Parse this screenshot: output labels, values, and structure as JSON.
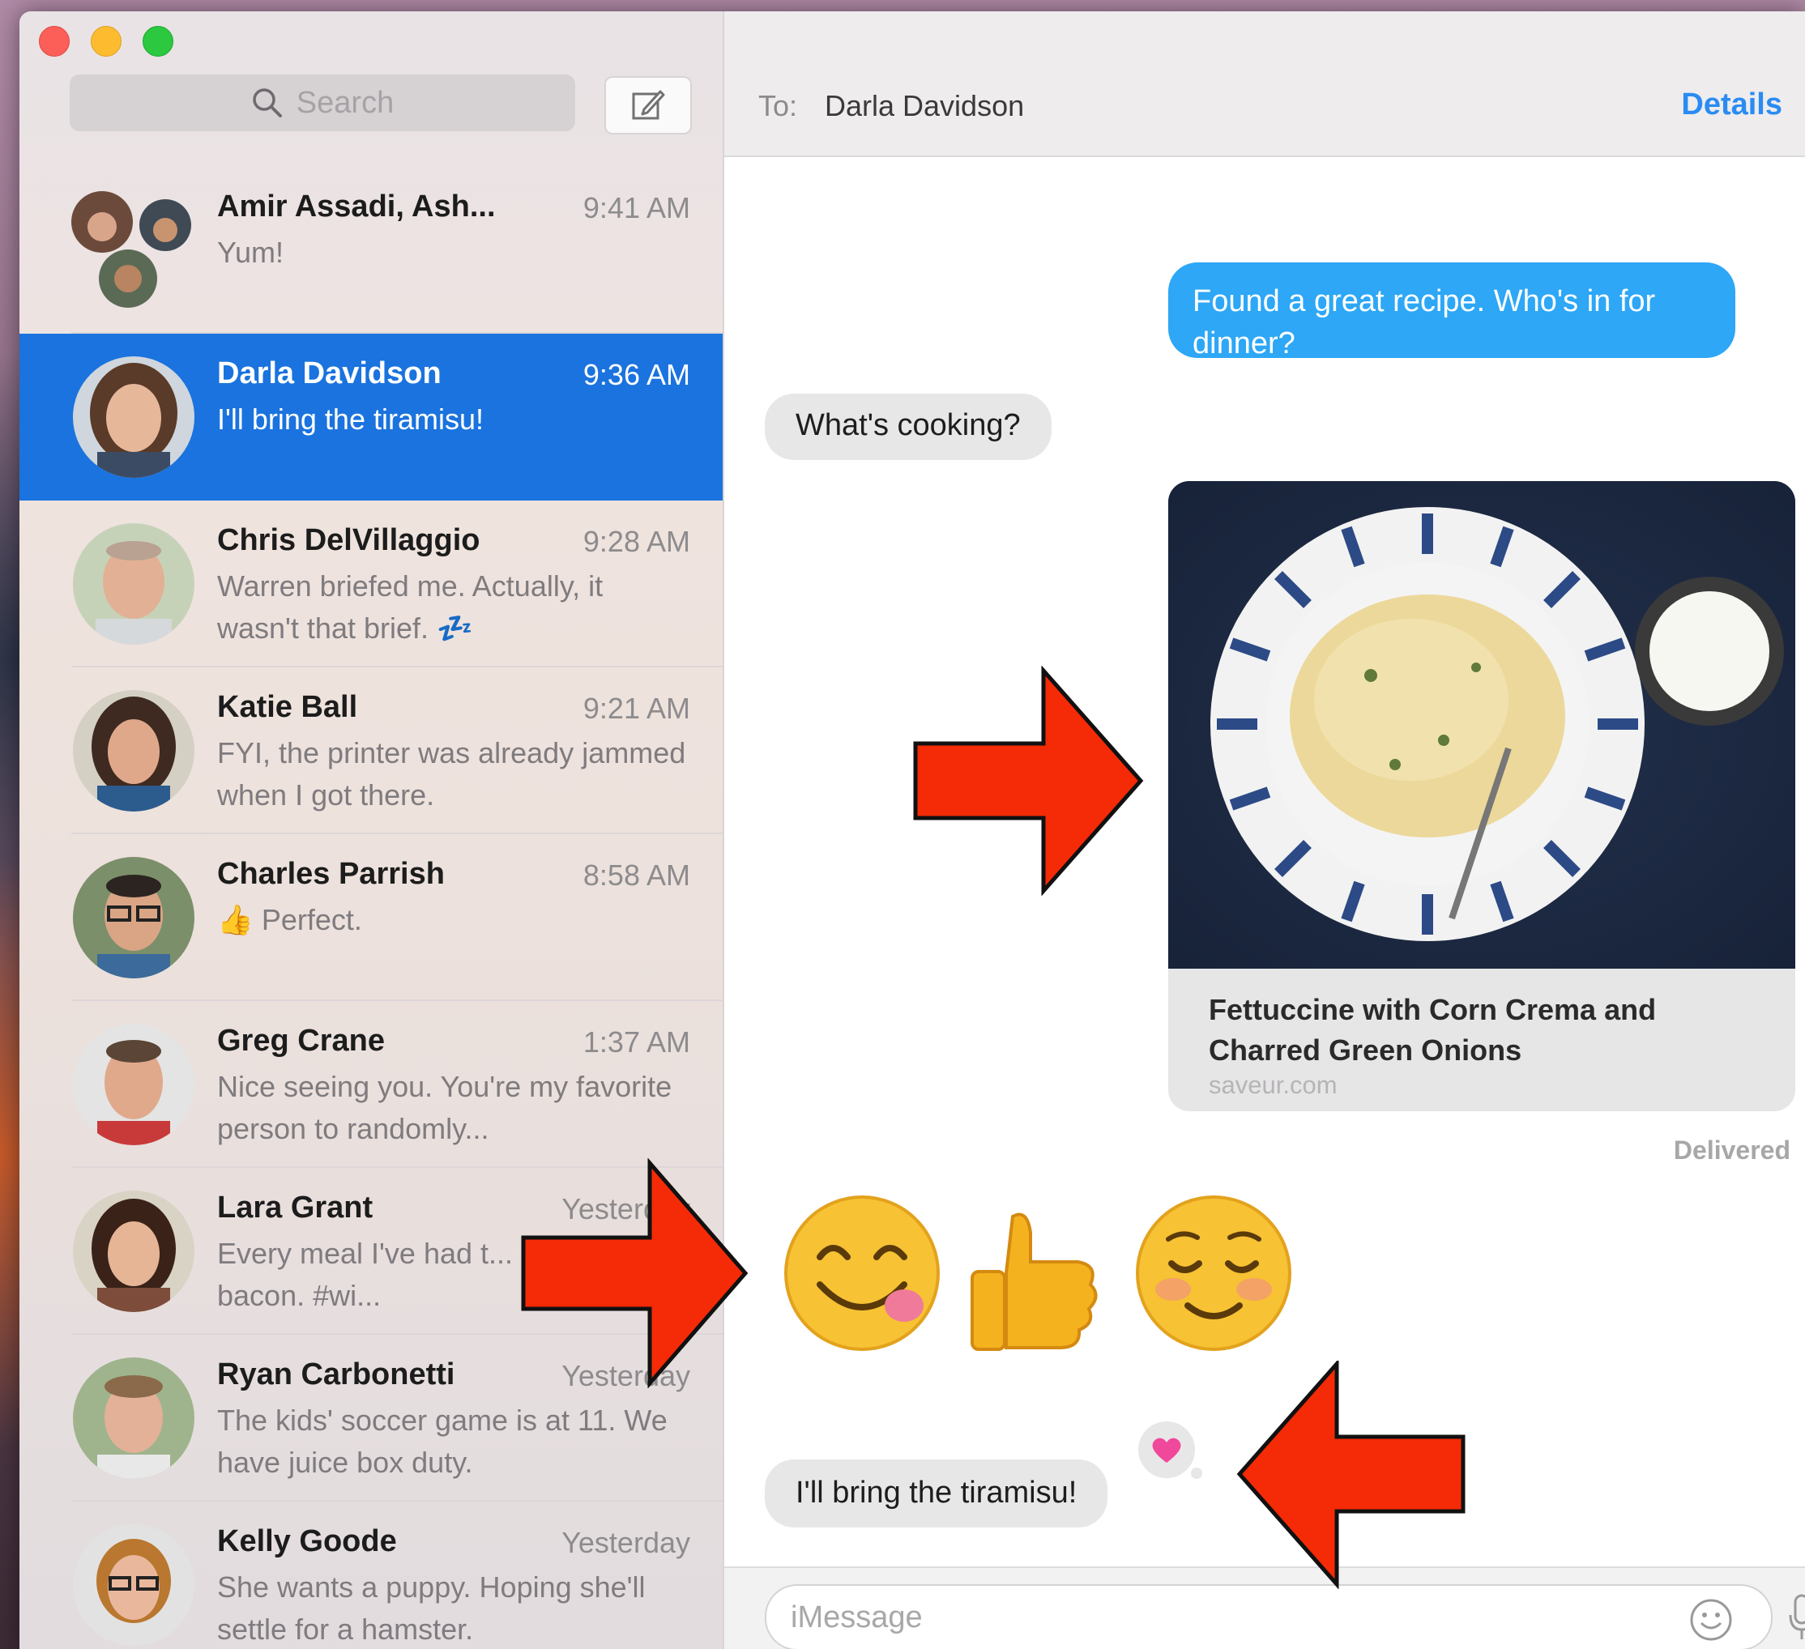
{
  "search": {
    "placeholder": "Search"
  },
  "conversations": [
    {
      "name": "Amir Assadi, Ash...",
      "time": "9:41 AM",
      "preview": "Yum!"
    },
    {
      "name": "Darla Davidson",
      "time": "9:36 AM",
      "preview": "I'll bring the tiramisu!"
    },
    {
      "name": "Chris DelVillaggio",
      "time": "9:28 AM",
      "preview": "Warren briefed me. Actually, it wasn't that brief. 💤"
    },
    {
      "name": "Katie Ball",
      "time": "9:21 AM",
      "preview": "FYI, the printer was already jammed when I got there."
    },
    {
      "name": "Charles Parrish",
      "time": "8:58 AM",
      "preview": "👍 Perfect."
    },
    {
      "name": "Greg Crane",
      "time": "1:37 AM",
      "preview": "Nice seeing you. You're my favorite person to randomly..."
    },
    {
      "name": "Lara Grant",
      "time": "Yesterday",
      "preview": "Every meal I've had t... included bacon. #wi..."
    },
    {
      "name": "Ryan Carbonetti",
      "time": "Yesterday",
      "preview": "The kids' soccer game is at 11. We have juice box duty."
    },
    {
      "name": "Kelly Goode",
      "time": "Yesterday",
      "preview": "She wants a puppy. Hoping she'll settle for a hamster."
    }
  ],
  "header": {
    "to_label": "To:",
    "to_name": "Darla Davidson",
    "details": "Details"
  },
  "messages": {
    "m1": "Found a great recipe. Who's in for dinner?",
    "m2": "What's cooking?",
    "link_title": "Fettuccine with Corn Crema and Charred Green Onions",
    "link_domain": "saveur.com",
    "delivered": "Delivered",
    "m3": "I'll bring the tiramisu!"
  },
  "input": {
    "placeholder": "iMessage"
  },
  "colors": {
    "selection": "#1a73de",
    "outgoing_bubble": "#2da7f6",
    "incoming_bubble": "#e8e7e8",
    "link_color": "#2a8cf2",
    "annotation_arrow": "#f52a06"
  }
}
